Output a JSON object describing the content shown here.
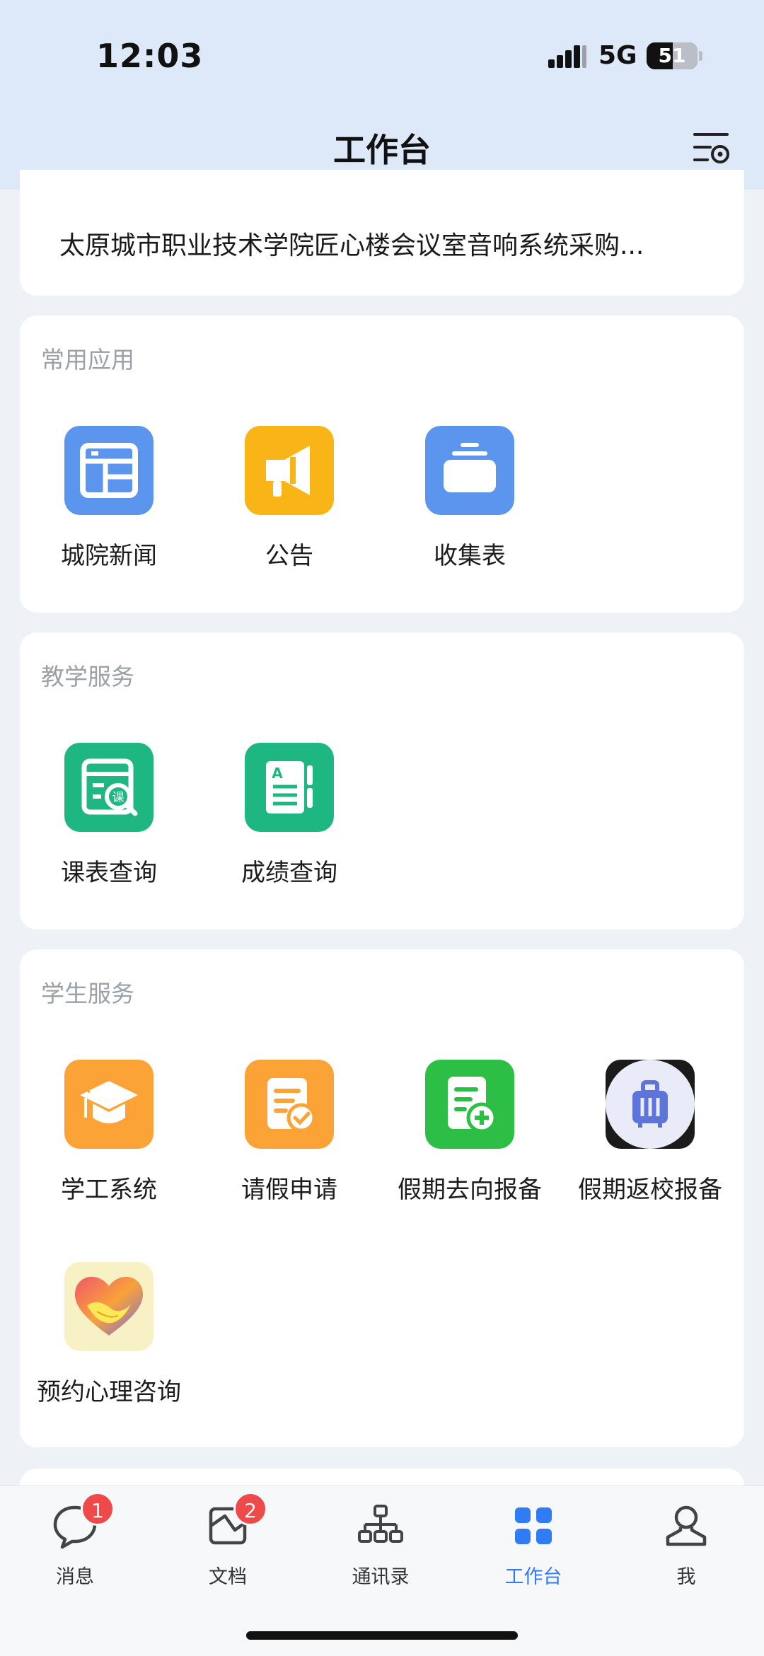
{
  "status_bar": {
    "time": "12:03",
    "network": "5G",
    "battery_level": "51",
    "battery_fraction": 0.51
  },
  "nav": {
    "title": "工作台",
    "settings_icon": "list-settings-icon"
  },
  "news": {
    "text": "太原城市职业技术学院匠心楼会议室音响系统采购..."
  },
  "sections": {
    "common": {
      "title": "常用应用",
      "apps": [
        {
          "label": "城院新闻",
          "icon": "newspaper-icon",
          "color": "#5b95ee"
        },
        {
          "label": "公告",
          "icon": "megaphone-icon",
          "color": "#f9b418"
        },
        {
          "label": "收集表",
          "icon": "collection-box-icon",
          "color": "#5b95ee"
        }
      ]
    },
    "teaching": {
      "title": "教学服务",
      "apps": [
        {
          "label": "课表查询",
          "icon": "timetable-search-icon",
          "color": "#1eb781"
        },
        {
          "label": "成绩查询",
          "icon": "grade-book-icon",
          "color": "#1eb781"
        }
      ]
    },
    "student": {
      "title": "学生服务",
      "apps": [
        {
          "label": "学工系统",
          "icon": "graduation-cap-icon",
          "color": "#fba336"
        },
        {
          "label": "请假申请",
          "icon": "leave-request-icon",
          "color": "#fba336"
        },
        {
          "label": "假期去向报备",
          "icon": "add-document-icon",
          "color": "#2dbe46"
        },
        {
          "label": "假期返校报备",
          "icon": "luggage-icon",
          "color": "#5d74d8"
        },
        {
          "label": "预约心理咨询",
          "icon": "heart-handshake-icon",
          "color": "#f7f1c5"
        }
      ]
    }
  },
  "tabbar": {
    "items": [
      {
        "label": "消息",
        "icon": "chat-bubble-icon",
        "badge": "1"
      },
      {
        "label": "文档",
        "icon": "document-icon",
        "badge": "2"
      },
      {
        "label": "通讯录",
        "icon": "org-chart-icon"
      },
      {
        "label": "工作台",
        "icon": "grid-apps-icon",
        "active": true
      },
      {
        "label": "我",
        "icon": "person-icon"
      }
    ],
    "active_color": "#2f7cf6"
  }
}
